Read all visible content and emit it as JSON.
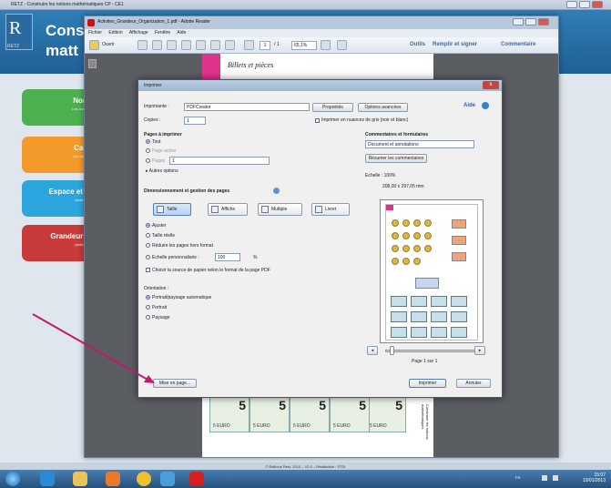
{
  "outer_window": {
    "title": "RETZ - Construire les notions mathématiques CP - CE1"
  },
  "retz": {
    "logo_text": "RETZ",
    "title_line1": "Cons",
    "title_line2": "matt",
    "categories": [
      {
        "label": "Nom",
        "sub": "Les nombr"
      },
      {
        "label": "Calc",
        "sub": "Les faits n"
      },
      {
        "label": "Espace et g",
        "sub": "(activités"
      },
      {
        "label": "Grandeur e",
        "sub": "(activités"
      }
    ],
    "footer": "© Éditions Retz, 2010 – V2.0 – Réalisation : STDI"
  },
  "reader": {
    "title": "Activites_Grandeur_Organization_1.pdf - Adobe Reader",
    "menu": [
      "Fichier",
      "Edition",
      "Affichage",
      "Fenêtre",
      "Aide"
    ],
    "open_label": "Ouvrir",
    "page_current": "1",
    "page_total": "/ 1",
    "zoom": "65,1%",
    "tools": "Outils",
    "fill_sign": "Remplir et signer",
    "comment": "Commentaire",
    "doc_heading": "Billets et pièces",
    "note_value": "5",
    "note_currency": "5 EURO",
    "doc_footer": "Construire les notions mathématiques"
  },
  "dialog": {
    "title": "Imprimer",
    "printer_label": "Imprimante :",
    "printer_value": "PDFCreator",
    "properties_button": "Propriétés",
    "advanced_button": "Options avancées",
    "help_link": "Aide",
    "copies_label": "Copies :",
    "copies_value": "1",
    "grayscale_label": "Imprimer en nuances de gris (noir et blanc)",
    "pages_heading": "Pages à imprimer",
    "pages_all": "Tout",
    "pages_current": "Page active",
    "pages_range": "Pages",
    "pages_range_value": "1",
    "more_options": "Autres options",
    "sizing_heading": "Dimensionnement et gestion des pages",
    "size_btn": "Taille",
    "poster_btn": "Affiche",
    "multiple_btn": "Multiple",
    "booklet_btn": "Livret",
    "fit": "Ajuster",
    "actual_size": "Taille réelle",
    "shrink": "Réduire les pages hors format",
    "custom_scale": "Echelle personnalisée :",
    "custom_scale_value": "100",
    "percent": "%",
    "paper_source": "Choisir la source de papier selon le format de la page PDF",
    "orientation_heading": "Orientation :",
    "orient_auto": "Portrait/paysage automatique",
    "orient_portrait": "Portrait",
    "orient_landscape": "Paysage",
    "comments_heading": "Commentaires et formulaires",
    "comments_value": "Document et annotations",
    "summarize_button": "Résumer les commentaires",
    "scale_info": "Echelle : 100%",
    "paper_size": "208,00 x 297,05 mm",
    "page_indicator": "Page 1 sur 1",
    "page_setup_button": "Mise en page...",
    "print_button": "Imprimer",
    "cancel_button": "Annuler"
  },
  "taskbar": {
    "lang": "FR",
    "time": "15:07",
    "date": "19/01/2013"
  },
  "colors": {
    "accent_blue": "#2f7fb7",
    "pink": "#e0338c",
    "arrow": "#c2186e"
  }
}
